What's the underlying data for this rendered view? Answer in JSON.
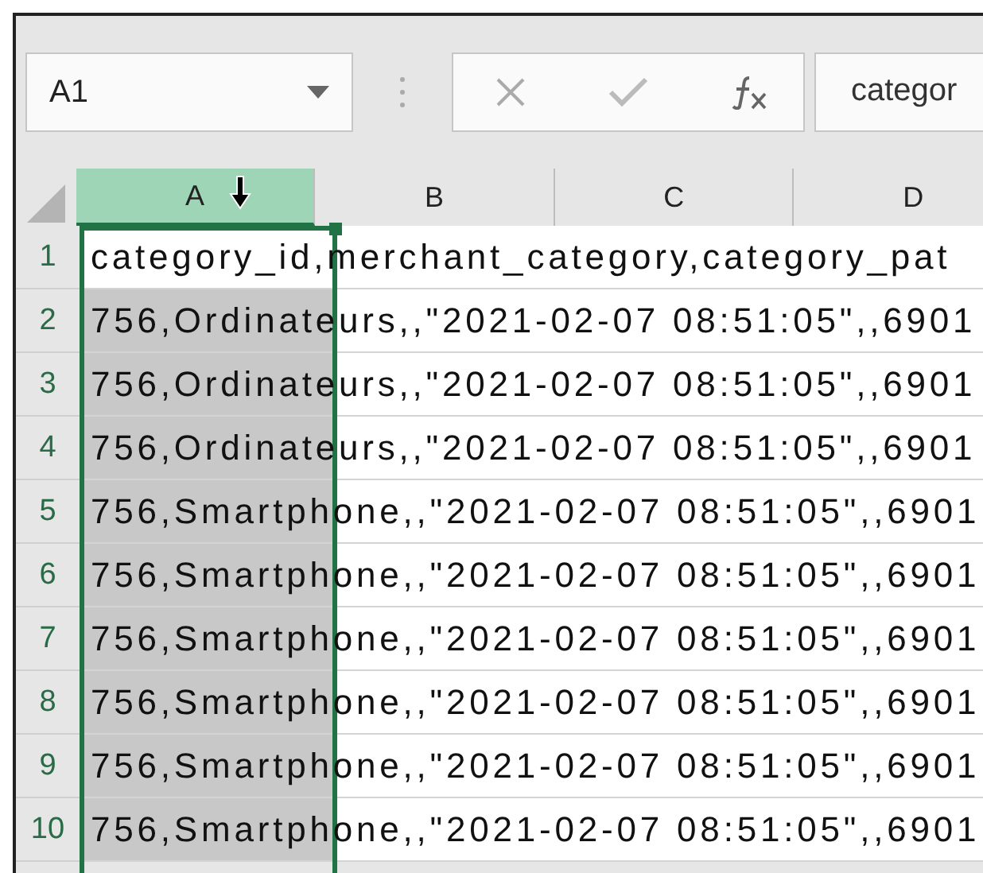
{
  "name_box": {
    "value": "A1"
  },
  "formula_bar": {
    "value": "categor"
  },
  "columns": [
    {
      "label": "A",
      "selected": true
    },
    {
      "label": "B",
      "selected": false
    },
    {
      "label": "C",
      "selected": false
    },
    {
      "label": "D",
      "selected": false
    }
  ],
  "rows": [
    {
      "number": "1",
      "text": "category_id,merchant_category,category_pat",
      "active": true
    },
    {
      "number": "2",
      "text": "756,Ordinateurs,,\"2021-02-07 08:51:05\",,6901",
      "active": false
    },
    {
      "number": "3",
      "text": "756,Ordinateurs,,\"2021-02-07 08:51:05\",,6901",
      "active": false
    },
    {
      "number": "4",
      "text": "756,Ordinateurs,,\"2021-02-07 08:51:05\",,6901",
      "active": false
    },
    {
      "number": "5",
      "text": "756,Smartphone,,\"2021-02-07 08:51:05\",,6901",
      "active": false
    },
    {
      "number": "6",
      "text": "756,Smartphone,,\"2021-02-07 08:51:05\",,6901",
      "active": false
    },
    {
      "number": "7",
      "text": "756,Smartphone,,\"2021-02-07 08:51:05\",,6901",
      "active": false
    },
    {
      "number": "8",
      "text": "756,Smartphone,,\"2021-02-07 08:51:05\",,6901",
      "active": false
    },
    {
      "number": "9",
      "text": "756,Smartphone,,\"2021-02-07 08:51:05\",,6901",
      "active": false
    },
    {
      "number": "10",
      "text": "756,Smartphone,,\"2021-02-07 08:51:05\",,6901",
      "active": false
    }
  ]
}
